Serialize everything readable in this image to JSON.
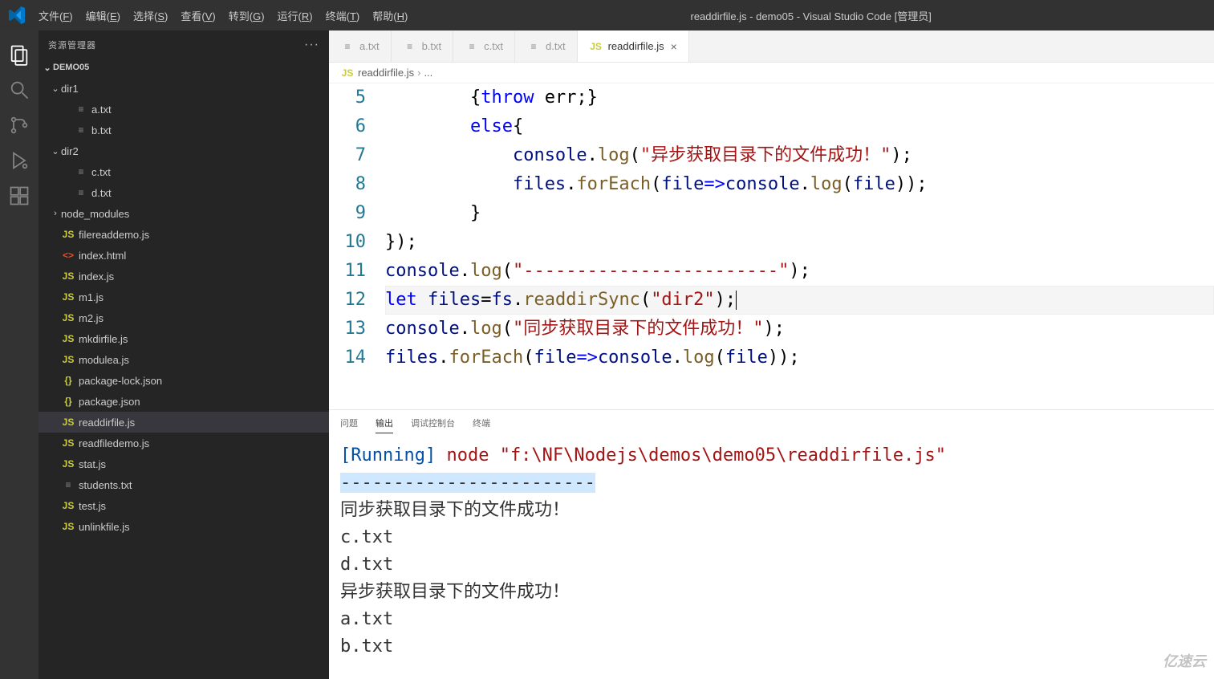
{
  "window_title": "readdirfile.js - demo05 - Visual Studio Code [管理员]",
  "menubar": [
    "文件(F)",
    "编辑(E)",
    "选择(S)",
    "查看(V)",
    "转到(G)",
    "运行(R)",
    "终端(T)",
    "帮助(H)"
  ],
  "sidebar": {
    "title": "资源管理器",
    "root": "DEMO05",
    "tree": [
      {
        "depth": 0,
        "type": "folder",
        "name": "dir1",
        "expanded": true
      },
      {
        "depth": 1,
        "type": "file",
        "name": "a.txt",
        "icon": "txt"
      },
      {
        "depth": 1,
        "type": "file",
        "name": "b.txt",
        "icon": "txt"
      },
      {
        "depth": 0,
        "type": "folder",
        "name": "dir2",
        "expanded": true
      },
      {
        "depth": 1,
        "type": "file",
        "name": "c.txt",
        "icon": "txt"
      },
      {
        "depth": 1,
        "type": "file",
        "name": "d.txt",
        "icon": "txt"
      },
      {
        "depth": 0,
        "type": "folder",
        "name": "node_modules",
        "expanded": false
      },
      {
        "depth": 0,
        "type": "file",
        "name": "filereaddemo.js",
        "icon": "js"
      },
      {
        "depth": 0,
        "type": "file",
        "name": "index.html",
        "icon": "html"
      },
      {
        "depth": 0,
        "type": "file",
        "name": "index.js",
        "icon": "js"
      },
      {
        "depth": 0,
        "type": "file",
        "name": "m1.js",
        "icon": "js"
      },
      {
        "depth": 0,
        "type": "file",
        "name": "m2.js",
        "icon": "js"
      },
      {
        "depth": 0,
        "type": "file",
        "name": "mkdirfile.js",
        "icon": "js"
      },
      {
        "depth": 0,
        "type": "file",
        "name": "modulea.js",
        "icon": "js"
      },
      {
        "depth": 0,
        "type": "file",
        "name": "package-lock.json",
        "icon": "json"
      },
      {
        "depth": 0,
        "type": "file",
        "name": "package.json",
        "icon": "json"
      },
      {
        "depth": 0,
        "type": "file",
        "name": "readdirfile.js",
        "icon": "js",
        "selected": true
      },
      {
        "depth": 0,
        "type": "file",
        "name": "readfiledemo.js",
        "icon": "js"
      },
      {
        "depth": 0,
        "type": "file",
        "name": "stat.js",
        "icon": "js"
      },
      {
        "depth": 0,
        "type": "file",
        "name": "students.txt",
        "icon": "txt"
      },
      {
        "depth": 0,
        "type": "file",
        "name": "test.js",
        "icon": "js"
      },
      {
        "depth": 0,
        "type": "file",
        "name": "unlinkfile.js",
        "icon": "js"
      }
    ]
  },
  "tabs": [
    {
      "label": "a.txt",
      "icon": "txt"
    },
    {
      "label": "b.txt",
      "icon": "txt"
    },
    {
      "label": "c.txt",
      "icon": "txt"
    },
    {
      "label": "d.txt",
      "icon": "txt"
    },
    {
      "label": "readdirfile.js",
      "icon": "js",
      "active": true
    }
  ],
  "breadcrumb": {
    "file": "readdirfile.js",
    "trail": "..."
  },
  "code_lines": [
    {
      "n": 5,
      "tokens": [
        [
          "        {",
          "punc"
        ],
        [
          "throw",
          "kw"
        ],
        [
          " err;}",
          "punc"
        ]
      ]
    },
    {
      "n": 6,
      "tokens": [
        [
          "        ",
          "punc"
        ],
        [
          "else",
          "kw"
        ],
        [
          "{",
          "punc"
        ]
      ]
    },
    {
      "n": 7,
      "tokens": [
        [
          "            ",
          "punc"
        ],
        [
          "console",
          "id"
        ],
        [
          ".",
          "punc"
        ],
        [
          "log",
          "fn"
        ],
        [
          "(",
          "punc"
        ],
        [
          "\"异步获取目录下的文件成功！\"",
          "str"
        ],
        [
          ");",
          "punc"
        ]
      ]
    },
    {
      "n": 8,
      "tokens": [
        [
          "            ",
          "punc"
        ],
        [
          "files",
          "id"
        ],
        [
          ".",
          "punc"
        ],
        [
          "forEach",
          "fn"
        ],
        [
          "(",
          "punc"
        ],
        [
          "file",
          "id"
        ],
        [
          "=>",
          "kw"
        ],
        [
          "console",
          "id"
        ],
        [
          ".",
          "punc"
        ],
        [
          "log",
          "fn"
        ],
        [
          "(",
          "punc"
        ],
        [
          "file",
          "id"
        ],
        [
          "));",
          "punc"
        ]
      ]
    },
    {
      "n": 9,
      "tokens": [
        [
          "        }",
          "punc"
        ]
      ]
    },
    {
      "n": 10,
      "tokens": [
        [
          "});",
          "punc"
        ]
      ]
    },
    {
      "n": 11,
      "tokens": [
        [
          "console",
          "id"
        ],
        [
          ".",
          "punc"
        ],
        [
          "log",
          "fn"
        ],
        [
          "(",
          "punc"
        ],
        [
          "\"------------------------\"",
          "str"
        ],
        [
          ");",
          "punc"
        ]
      ]
    },
    {
      "n": 12,
      "current": true,
      "tokens": [
        [
          "let",
          "kw"
        ],
        [
          " ",
          "punc"
        ],
        [
          "files",
          "id"
        ],
        [
          "=",
          "punc"
        ],
        [
          "fs",
          "id"
        ],
        [
          ".",
          "punc"
        ],
        [
          "readdirSync",
          "fn"
        ],
        [
          "(",
          "punc"
        ],
        [
          "\"dir2\"",
          "str"
        ],
        [
          ");",
          "punc"
        ]
      ]
    },
    {
      "n": 13,
      "tokens": [
        [
          "console",
          "id"
        ],
        [
          ".",
          "punc"
        ],
        [
          "log",
          "fn"
        ],
        [
          "(",
          "punc"
        ],
        [
          "\"同步获取目录下的文件成功！\"",
          "str"
        ],
        [
          ");",
          "punc"
        ]
      ]
    },
    {
      "n": 14,
      "tokens": [
        [
          "files",
          "id"
        ],
        [
          ".",
          "punc"
        ],
        [
          "forEach",
          "fn"
        ],
        [
          "(",
          "punc"
        ],
        [
          "file",
          "id"
        ],
        [
          "=>",
          "kw"
        ],
        [
          "console",
          "id"
        ],
        [
          ".",
          "punc"
        ],
        [
          "log",
          "fn"
        ],
        [
          "(",
          "punc"
        ],
        [
          "file",
          "id"
        ],
        [
          "));",
          "punc"
        ]
      ]
    }
  ],
  "panel": {
    "tabs": [
      "问题",
      "输出",
      "调试控制台",
      "终端"
    ],
    "active_tab": "输出",
    "running_label": "[Running]",
    "command": "node \"f:\\NF\\Nodejs\\demos\\demo05\\readdirfile.js\"",
    "output_lines": [
      {
        "text": "------------------------",
        "hl": true
      },
      {
        "text": "同步获取目录下的文件成功！"
      },
      {
        "text": "c.txt"
      },
      {
        "text": "d.txt"
      },
      {
        "text": "异步获取目录下的文件成功！"
      },
      {
        "text": "a.txt"
      },
      {
        "text": "b.txt"
      }
    ]
  },
  "watermark": "亿速云"
}
